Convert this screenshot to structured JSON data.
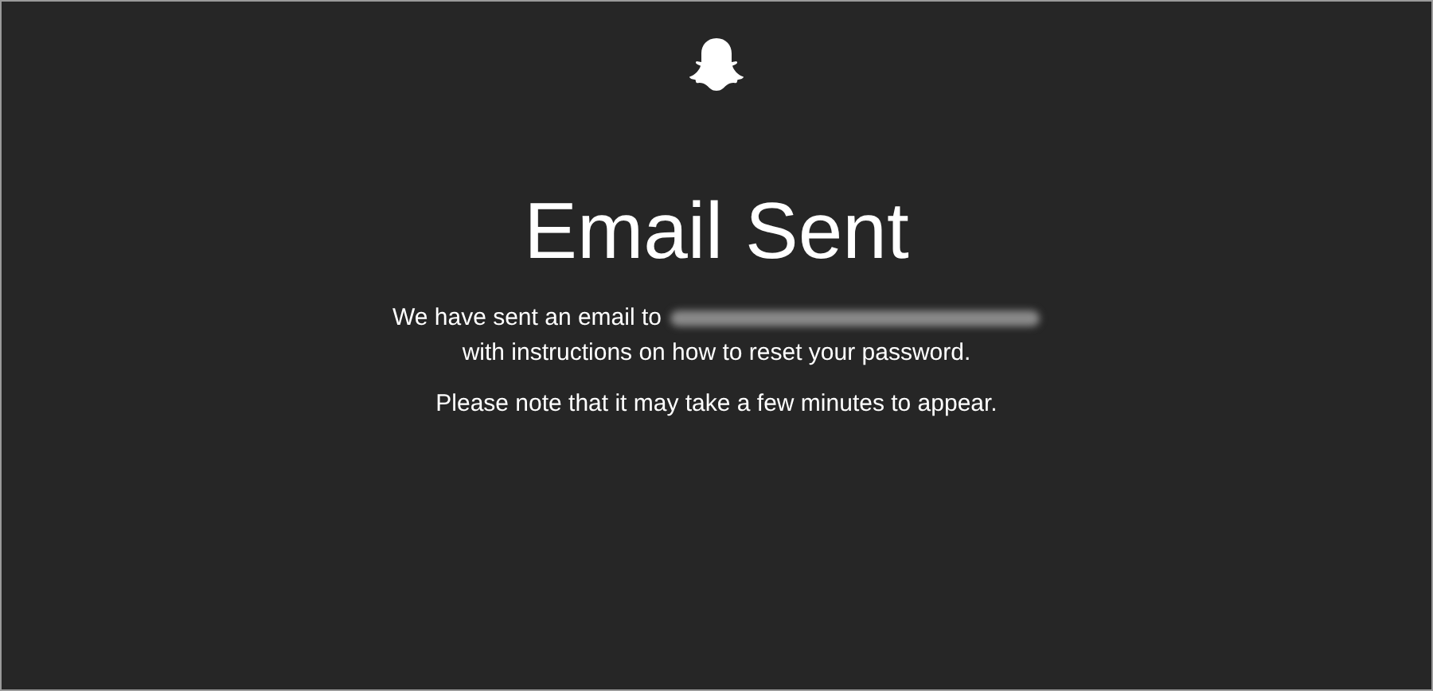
{
  "title": "Email Sent",
  "message": {
    "before_email": "We have sent an email to",
    "after_email": "with instructions on how to reset your password."
  },
  "note": "Please note that it may take a few minutes to appear."
}
